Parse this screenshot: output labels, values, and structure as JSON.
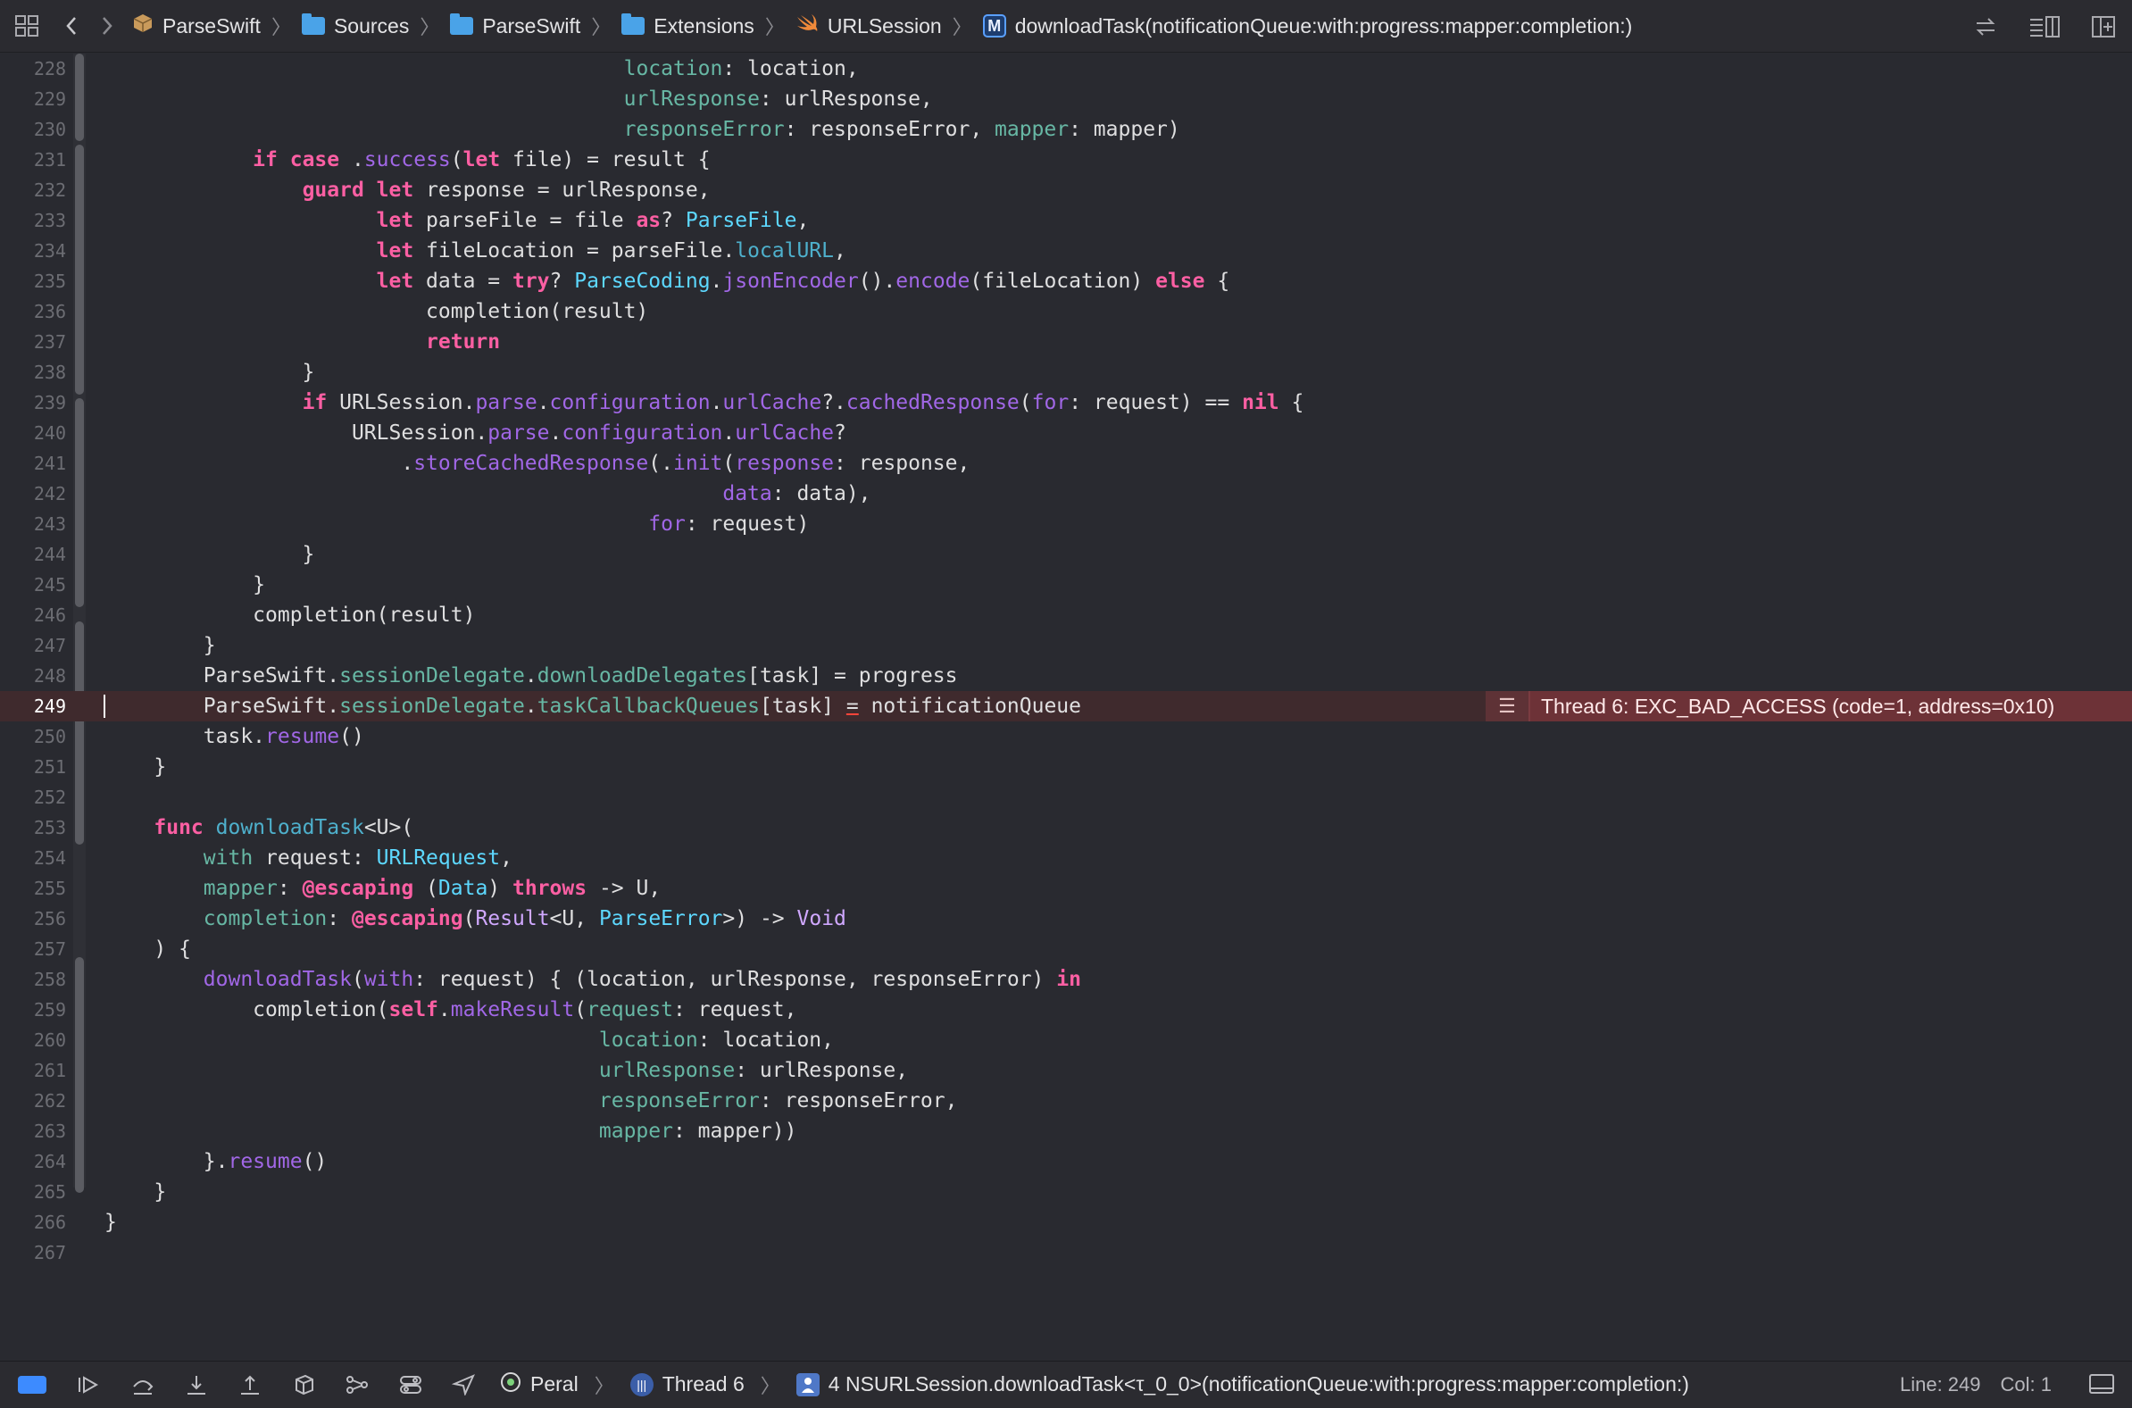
{
  "breadcrumb": [
    {
      "label": "ParseSwift",
      "icon": "package-icon"
    },
    {
      "label": "Sources",
      "icon": "folder-icon"
    },
    {
      "label": "ParseSwift",
      "icon": "folder-icon"
    },
    {
      "label": "Extensions",
      "icon": "folder-icon"
    },
    {
      "label": "URLSession",
      "icon": "swift-file-icon"
    },
    {
      "label": "downloadTask(notificationQueue:with:progress:mapper:completion:)",
      "icon": "method-icon",
      "badge": "M"
    }
  ],
  "editor": {
    "current_line": 249,
    "error": {
      "line": 249,
      "message": "Thread 6: EXC_BAD_ACCESS (code=1, address=0x10)"
    },
    "lines": [
      {
        "n": "228",
        "html": "                                          <span class=\"p\">location</span>: location,"
      },
      {
        "n": "229",
        "html": "                                          <span class=\"p\">urlResponse</span>: urlResponse,"
      },
      {
        "n": "230",
        "html": "                                          <span class=\"p\">responseError</span>: responseError, <span class=\"p\">mapper</span>: mapper)"
      },
      {
        "n": "231",
        "html": "            <span class=\"k\">if</span> <span class=\"k\">case</span> .<span class=\"m\">success</span>(<span class=\"k\">let</span> file) = result {"
      },
      {
        "n": "232",
        "html": "                <span class=\"k\">guard</span> <span class=\"k\">let</span> response = urlResponse,"
      },
      {
        "n": "233",
        "html": "                      <span class=\"k\">let</span> parseFile = file <span class=\"k\">as</span>? <span class=\"t\">ParseFile</span>,"
      },
      {
        "n": "234",
        "html": "                      <span class=\"k\">let</span> fileLocation = parseFile.<span class=\"pf\">localURL</span>,"
      },
      {
        "n": "235",
        "html": "                      <span class=\"k\">let</span> data = <span class=\"k\">try</span>? <span class=\"t\">ParseCoding</span>.<span class=\"m\">jsonEncoder</span>().<span class=\"m\">encode</span>(fileLocation) <span class=\"k\">else</span> {"
      },
      {
        "n": "236",
        "html": "                          completion(result)"
      },
      {
        "n": "237",
        "html": "                          <span class=\"k\">return</span>"
      },
      {
        "n": "238",
        "html": "                }"
      },
      {
        "n": "239",
        "html": "                <span class=\"k\">if</span> URLSession.<span class=\"m\">parse</span>.<span class=\"m\">configuration</span>.<span class=\"m\">urlCache</span>?.<span class=\"m\">cachedResponse</span>(<span class=\"pa\">for</span>: request) == <span class=\"k\">nil</span> {"
      },
      {
        "n": "240",
        "html": "                    URLSession.<span class=\"m\">parse</span>.<span class=\"m\">configuration</span>.<span class=\"m\">urlCache</span>?"
      },
      {
        "n": "241",
        "html": "                        .<span class=\"m\">storeCachedResponse</span>(.<span class=\"m\">init</span>(<span class=\"pa\">response</span>: response,"
      },
      {
        "n": "242",
        "html": "                                                  <span class=\"pa\">data</span>: data),"
      },
      {
        "n": "243",
        "html": "                                            <span class=\"pa\">for</span>: request)"
      },
      {
        "n": "244",
        "html": "                }"
      },
      {
        "n": "245",
        "html": "            }"
      },
      {
        "n": "246",
        "html": "            completion(result)"
      },
      {
        "n": "247",
        "html": "        }"
      },
      {
        "n": "248",
        "html": "        ParseSwift.<span class=\"p\">sessionDelegate</span>.<span class=\"p\">downloadDelegates</span>[task] = progress"
      },
      {
        "n": "249",
        "html": "        ParseSwift.<span class=\"p\">sessionDelegate</span>.<span class=\"p\">taskCallbackQueues</span>[task] <span class=\"err-u\">=</span> notificationQueue"
      },
      {
        "n": "250",
        "html": "        task.<span class=\"m\">resume</span>()"
      },
      {
        "n": "251",
        "html": "    }"
      },
      {
        "n": "252",
        "html": ""
      },
      {
        "n": "253",
        "html": "    <span class=\"k\">func</span> <span class=\"pf\">downloadTask</span>&lt;U&gt;("
      },
      {
        "n": "254",
        "html": "        <span class=\"p\">with</span> request: <span class=\"t\">URLRequest</span>,"
      },
      {
        "n": "255",
        "html": "        <span class=\"p\">mapper</span>: <span class=\"k\">@escaping</span> (<span class=\"t\">Data</span>) <span class=\"k\">throws</span> -&gt; U,"
      },
      {
        "n": "256",
        "html": "        <span class=\"p\">completion</span>: <span class=\"k\">@escaping</span>(<span class=\"tn\">Result</span>&lt;U, <span class=\"t\">ParseError</span>&gt;) -&gt; <span class=\"tn\">Void</span>"
      },
      {
        "n": "257",
        "html": "    ) {"
      },
      {
        "n": "258",
        "html": "        <span class=\"m\">downloadTask</span>(<span class=\"pa\">with</span>: request) { (location, urlResponse, responseError) <span class=\"k\">in</span>"
      },
      {
        "n": "259",
        "html": "            completion(<span class=\"k\">self</span>.<span class=\"m\">makeResult</span>(<span class=\"p\">request</span>: request,"
      },
      {
        "n": "260",
        "html": "                                        <span class=\"p\">location</span>: location,"
      },
      {
        "n": "261",
        "html": "                                        <span class=\"p\">urlResponse</span>: urlResponse,"
      },
      {
        "n": "262",
        "html": "                                        <span class=\"p\">responseError</span>: responseError,"
      },
      {
        "n": "263",
        "html": "                                        <span class=\"p\">mapper</span>: mapper))"
      },
      {
        "n": "264",
        "html": "        }.<span class=\"m\">resume</span>()"
      },
      {
        "n": "265",
        "html": "    }"
      },
      {
        "n": "266",
        "html": "}"
      },
      {
        "n": "267",
        "html": ""
      }
    ]
  },
  "debugbar": {
    "process": "Peral",
    "thread": "Thread 6",
    "frame": "4 NSURLSession.downloadTask<τ_0_0>(notificationQueue:with:progress:mapper:completion:)",
    "line_label": "Line: 249",
    "col_label": "Col: 1"
  },
  "colors": {
    "background": "#292a30",
    "keyword": "#fc5fa3",
    "type": "#5dd8ff",
    "property": "#67b7a4",
    "method": "#a167e6",
    "error_banner": "#6d3237",
    "current_line": "#3f2a2d"
  }
}
